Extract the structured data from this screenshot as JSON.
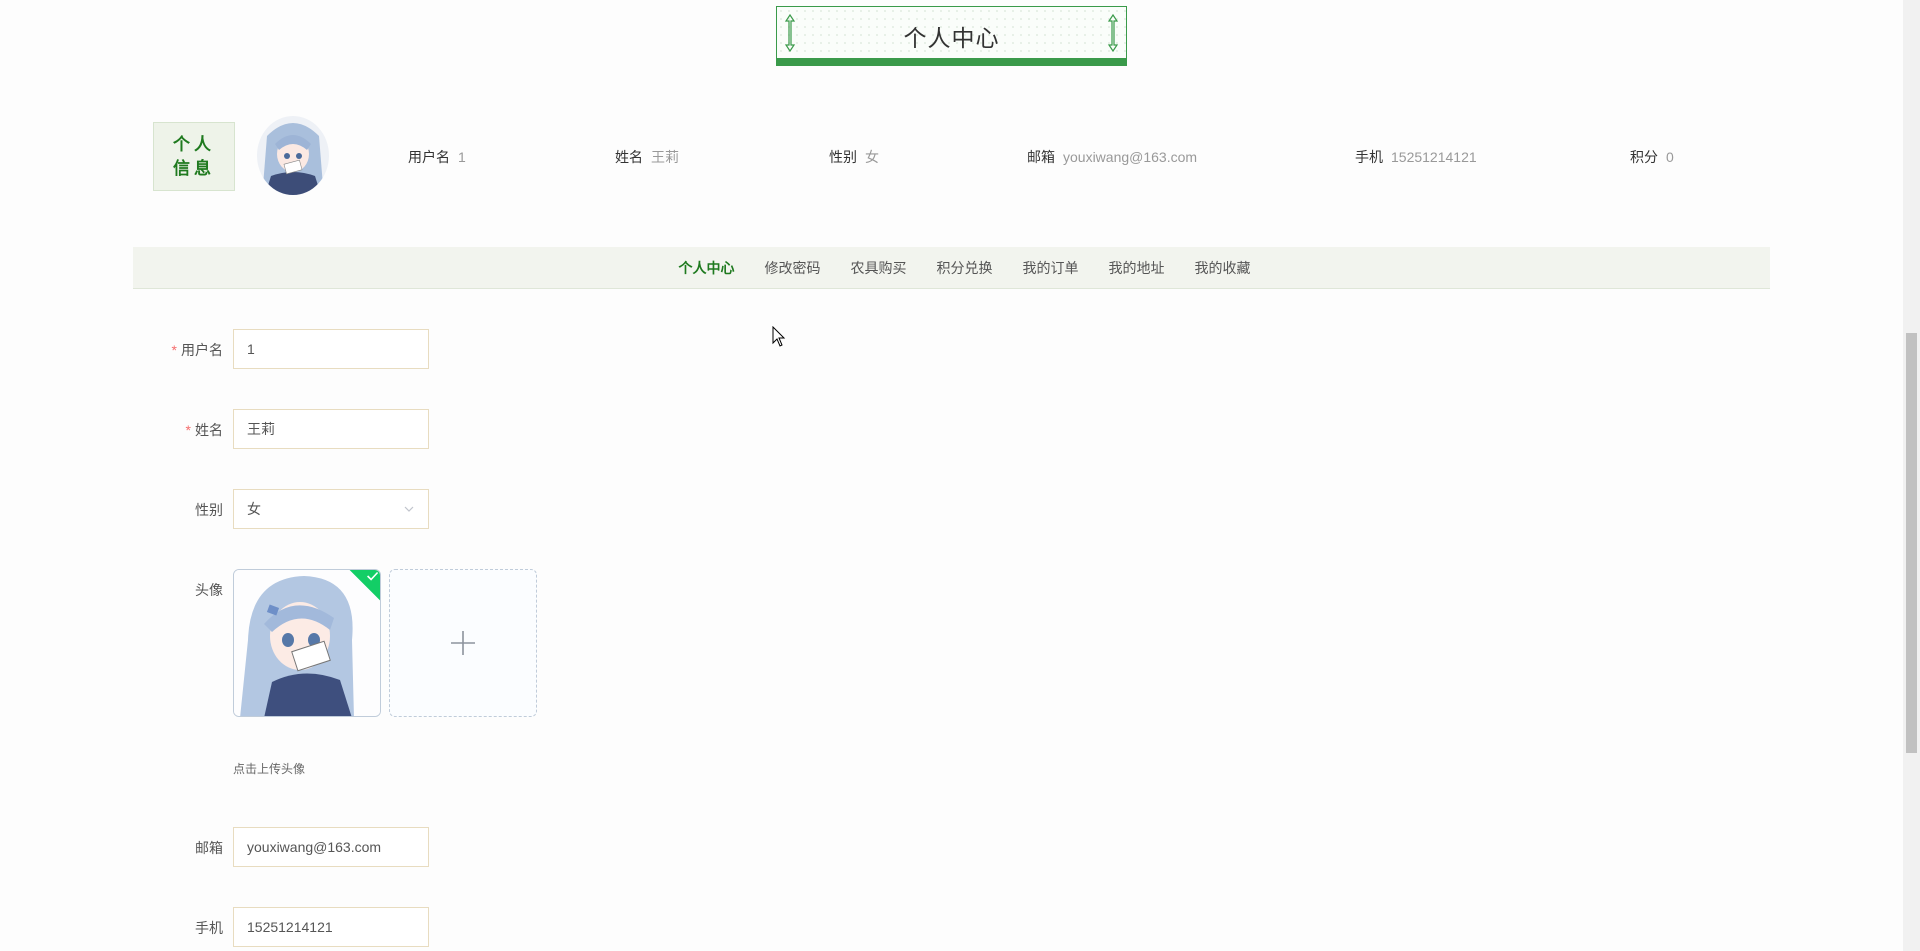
{
  "title": "个人中心",
  "info": {
    "badge": "个人信息",
    "fields": [
      {
        "label": "用户名",
        "value": "1"
      },
      {
        "label": "姓名",
        "value": "王莉"
      },
      {
        "label": "性别",
        "value": "女"
      },
      {
        "label": "邮箱",
        "value": "youxiwang@163.com"
      },
      {
        "label": "手机",
        "value": "15251214121"
      },
      {
        "label": "积分",
        "value": "0"
      }
    ]
  },
  "nav": [
    {
      "label": "个人中心",
      "active": true
    },
    {
      "label": "修改密码"
    },
    {
      "label": "农具购买"
    },
    {
      "label": "积分兑换"
    },
    {
      "label": "我的订单"
    },
    {
      "label": "我的地址"
    },
    {
      "label": "我的收藏"
    }
  ],
  "form": {
    "username": {
      "label": "用户名",
      "value": "1",
      "required": "*"
    },
    "name": {
      "label": "姓名",
      "value": "王莉",
      "required": "*"
    },
    "gender": {
      "label": "性别",
      "value": "女"
    },
    "avatar": {
      "label": "头像",
      "tip": "点击上传头像"
    },
    "email": {
      "label": "邮箱",
      "value": "youxiwang@163.com"
    },
    "phone": {
      "label": "手机",
      "value": "15251214121"
    }
  },
  "colors": {
    "accent": "#1f7a1f",
    "success": "#13ce66",
    "required": "#f56c6c"
  }
}
